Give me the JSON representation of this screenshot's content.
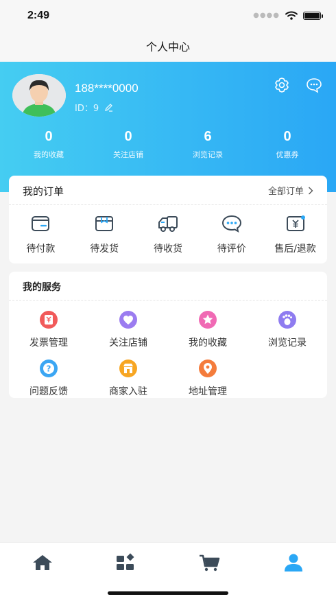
{
  "status": {
    "time": "2:49"
  },
  "nav": {
    "title": "个人中心"
  },
  "profile": {
    "username": "188****0000",
    "id_text": "ID：9"
  },
  "stats": [
    {
      "value": "0",
      "label": "我的收藏"
    },
    {
      "value": "0",
      "label": "关注店铺"
    },
    {
      "value": "6",
      "label": "浏览记录"
    },
    {
      "value": "0",
      "label": "优惠券"
    }
  ],
  "orders": {
    "title": "我的订单",
    "all_label": "全部订单",
    "items": [
      {
        "label": "待付款",
        "icon": "wallet-icon"
      },
      {
        "label": "待发货",
        "icon": "package-icon"
      },
      {
        "label": "待收货",
        "icon": "truck-icon"
      },
      {
        "label": "待评价",
        "icon": "chat-bubble-icon"
      },
      {
        "label": "售后/退款",
        "icon": "refund-icon"
      }
    ]
  },
  "services": {
    "title": "我的服务",
    "items": [
      {
        "label": "发票管理",
        "icon": "invoice-icon",
        "color": "#f15a5a"
      },
      {
        "label": "关注店铺",
        "icon": "heart-icon",
        "color": "#9b7cf0"
      },
      {
        "label": "我的收藏",
        "icon": "star-icon",
        "color": "#f06ab4"
      },
      {
        "label": "浏览记录",
        "icon": "footprint-icon",
        "color": "#8f7cf0"
      },
      {
        "label": "问题反馈",
        "icon": "question-icon",
        "color": "#3ba6f3"
      },
      {
        "label": "商家入驻",
        "icon": "store-icon",
        "color": "#f7a623"
      },
      {
        "label": "地址管理",
        "icon": "location-pin-icon",
        "color": "#f47c3c"
      }
    ]
  },
  "colors": {
    "accent": "#2aa7f5",
    "header_start": "#45cdf2",
    "tab_inactive": "#3c4b59"
  }
}
